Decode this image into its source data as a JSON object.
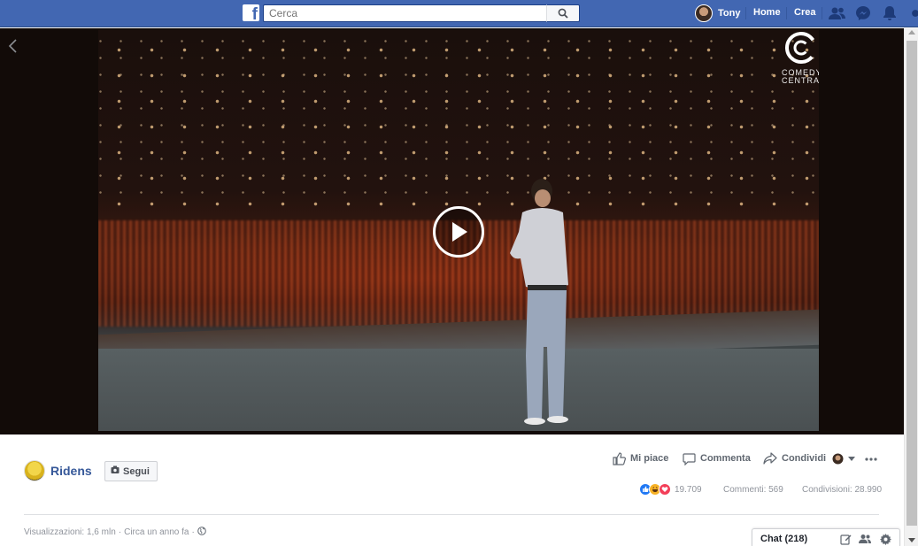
{
  "topbar": {
    "logo_letter": "f",
    "search_placeholder": "Cerca",
    "profile_name": "Tony",
    "nav": [
      "Home",
      "Crea"
    ],
    "icons": [
      "friends-icon",
      "messenger-icon",
      "notifications-icon"
    ]
  },
  "video": {
    "channel_logo_text": "COMEDY CENTRAL",
    "state": "paused"
  },
  "post": {
    "page_name": "Ridens",
    "follow_label": "Segui",
    "actions": {
      "like": "Mi piace",
      "comment": "Commenta",
      "share": "Condividi"
    },
    "reaction_count": "19.709",
    "comments": "Commenti: 569",
    "shares": "Condivisioni: 28.990",
    "views": "Visualizzazioni: 1,6 mln",
    "time": "Circa un anno fa"
  },
  "chat": {
    "label": "Chat (218)"
  },
  "colors": {
    "brand": "#4267b2",
    "link": "#365899",
    "muted": "#90949c"
  }
}
